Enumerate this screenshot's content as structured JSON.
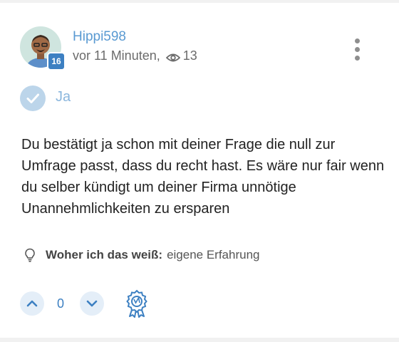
{
  "author": {
    "username": "Hippi598",
    "level": "16",
    "time_ago": "vor 11 Minuten,",
    "views": "13"
  },
  "answer": {
    "label": "Ja",
    "text": "Du bestätigt ja schon mit deiner Frage die null zur Umfrage passt, dass du recht hast. Es wäre nur fair wenn du selber kündigt um deiner Firma unnötige Unannehmlichkeiten zu ersparen"
  },
  "source": {
    "label": "Woher ich das weiß:",
    "value": "eigene Erfahrung"
  },
  "votes": {
    "count": "0"
  },
  "icons": {
    "menu": "more-vertical-icon",
    "check": "check-icon",
    "views": "eye-icon",
    "source": "lightbulb-icon",
    "upvote": "chevron-up-icon",
    "downvote": "chevron-down-icon",
    "award": "award-ribbon-icon"
  },
  "colors": {
    "accent": "#3d80c2",
    "username": "#5a9ad2",
    "vote_bg": "#e4eef8"
  }
}
